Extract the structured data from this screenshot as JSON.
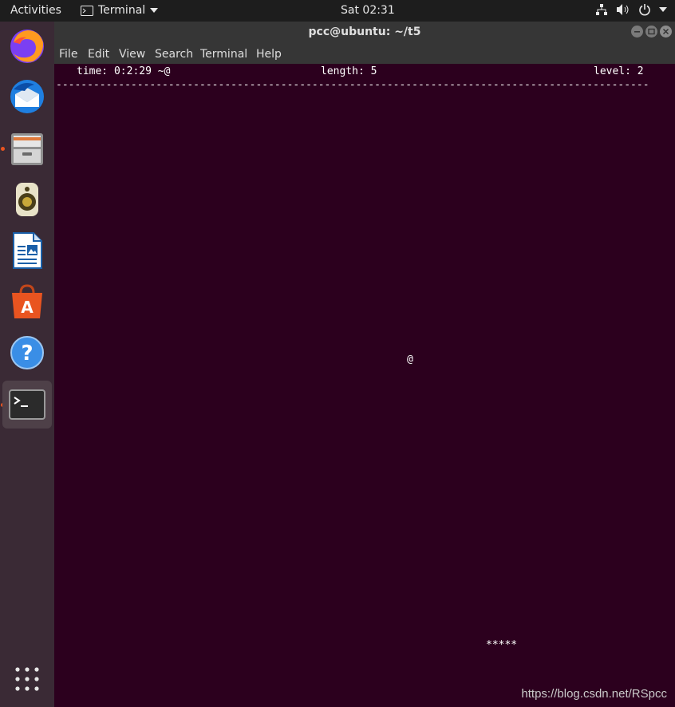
{
  "topbar": {
    "activities": "Activities",
    "app_name": "Terminal",
    "clock": "Sat 02:31"
  },
  "dock": {
    "items": [
      {
        "name": "firefox-icon"
      },
      {
        "name": "thunderbird-icon"
      },
      {
        "name": "files-icon",
        "running": true
      },
      {
        "name": "rhythmbox-icon"
      },
      {
        "name": "libreoffice-writer-icon"
      },
      {
        "name": "software-center-icon"
      },
      {
        "name": "help-icon"
      },
      {
        "name": "terminal-icon",
        "running": true,
        "active": true
      }
    ],
    "show_apps": "show-applications-icon"
  },
  "window": {
    "title": "pcc@ubuntu: ~/t5",
    "menu": [
      "File",
      "Edit",
      "View",
      "Search",
      "Terminal",
      "Help"
    ]
  },
  "terminal": {
    "status_time": "time: 0:2:29 ~@",
    "status_length": "length: 5",
    "status_level": "level: 2",
    "divider": "-----------------------------------------------------------------------------------------------",
    "food": "@",
    "snake": "*****"
  },
  "watermark": "https://blog.csdn.net/RSpcc",
  "colors": {
    "terminal_bg": "#2c001e",
    "topbar_bg": "#1d1d1d",
    "accent": "#e95420"
  }
}
